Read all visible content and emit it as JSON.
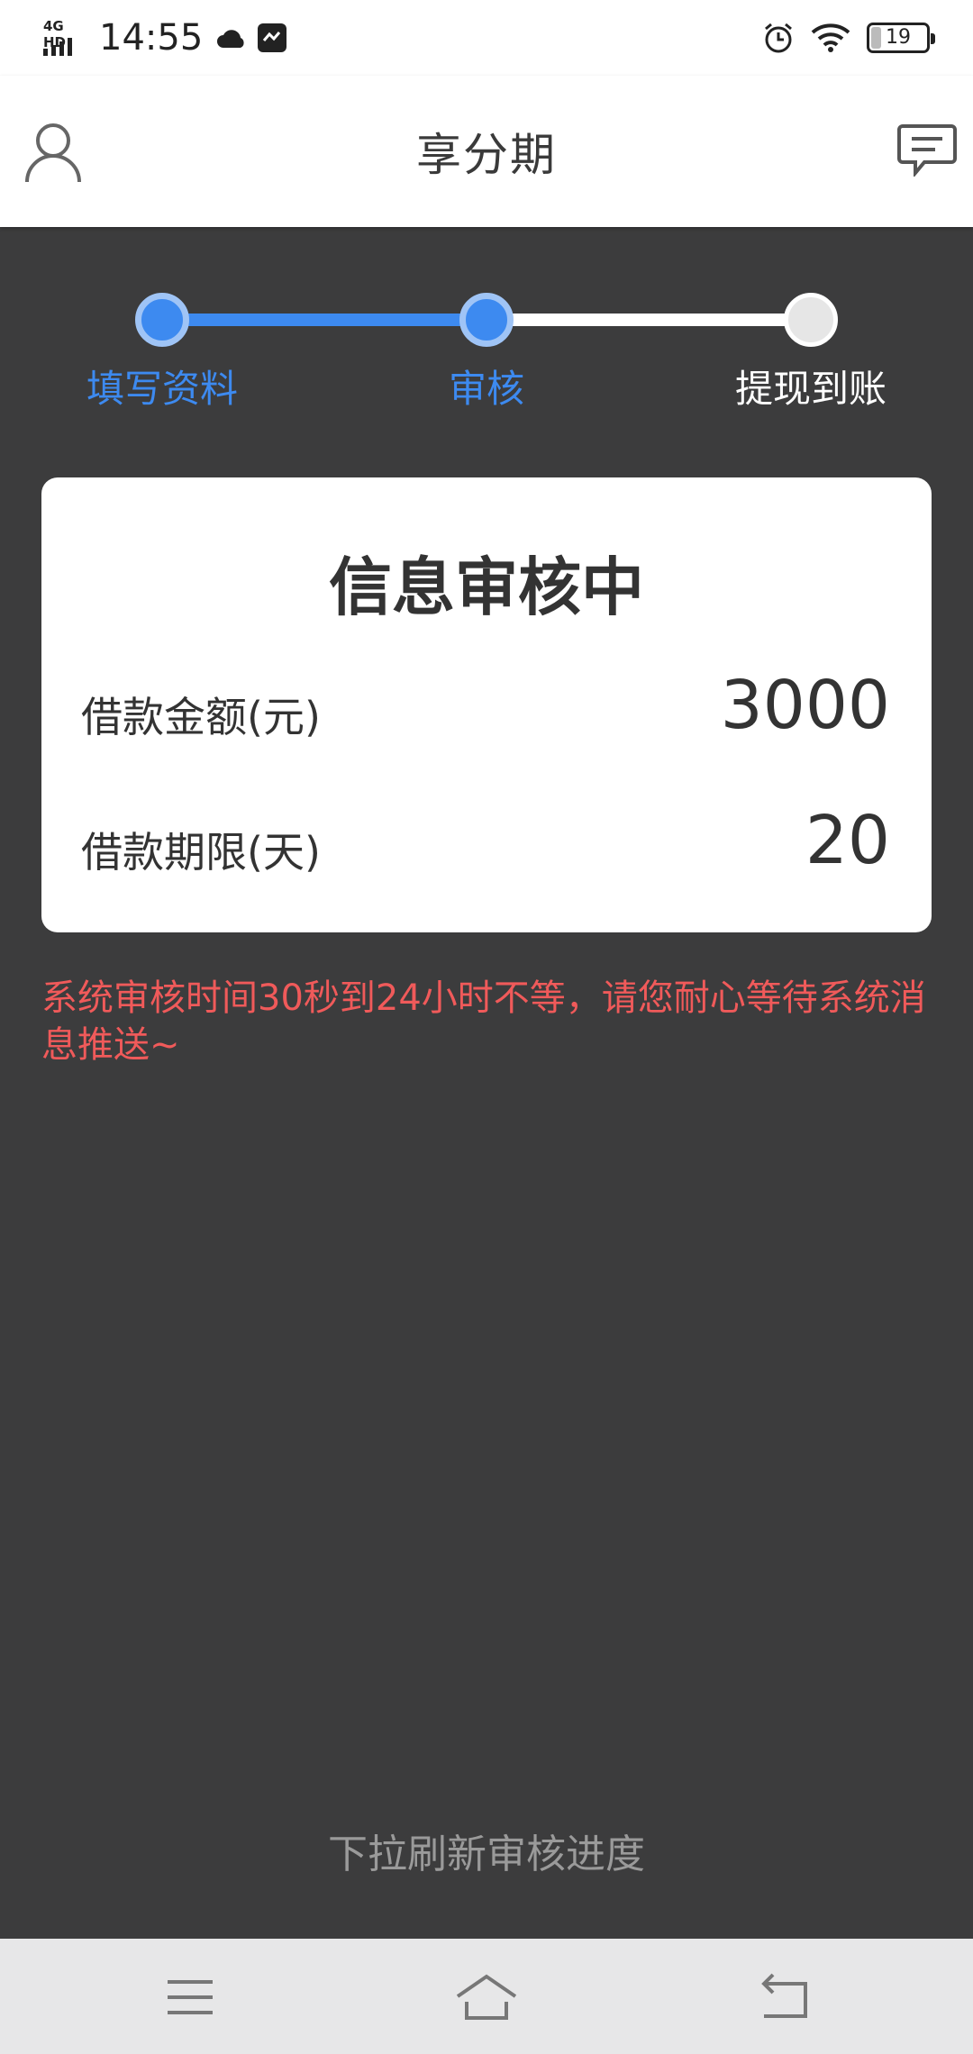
{
  "status_bar": {
    "network": "4G HD",
    "time": "14:55",
    "battery": "19",
    "battery_level": 0.19
  },
  "header": {
    "title": "享分期"
  },
  "steps": [
    {
      "label": "填写资料",
      "state": "active"
    },
    {
      "label": "审核",
      "state": "active"
    },
    {
      "label": "提现到账",
      "state": "todo"
    }
  ],
  "card": {
    "title": "信息审核中",
    "rows": [
      {
        "label": "借款金额(元)",
        "value": "3000"
      },
      {
        "label": "借款期限(天)",
        "value": "20"
      }
    ]
  },
  "notice": "系统审核时间30秒到24小时不等，请您耐心等待系统消息推送~",
  "pull_hint": "下拉刷新审核进度",
  "colors": {
    "accent": "#3d8af0",
    "warning": "#f05a5a",
    "background": "#3c3c3d"
  },
  "icons": {
    "avatar": "user-icon",
    "message": "message-icon",
    "nav_menu": "menu-icon",
    "nav_home": "home-icon",
    "nav_back": "back-icon"
  }
}
